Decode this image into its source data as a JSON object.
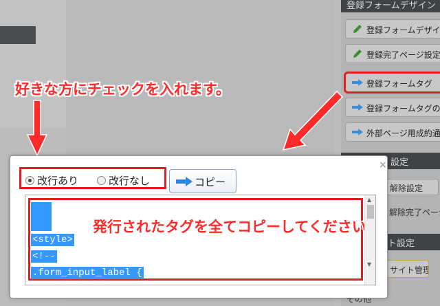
{
  "background": {
    "section_top": "登録フォームデザイン",
    "side_buttons": [
      {
        "label": "登録フォームデザイン"
      },
      {
        "label": "登録完了ページ設定"
      },
      {
        "label": "登録フォームタグ"
      },
      {
        "label": "登録フォームタグの"
      },
      {
        "label": "外部ページ用成約通知"
      }
    ],
    "section_mid": "設定",
    "side_small_1": "解除設定",
    "side_small_2": "解除完了ページ",
    "section_site": "ト設定",
    "site_manage": "サイト管理",
    "bottom_label": "その他"
  },
  "annotations": {
    "callout_top": "好きな方にチェックを入れます。",
    "callout_textarea": "発行されたタグを全てコピーしてください。"
  },
  "dialog": {
    "close": "×",
    "radio_on_label": "改行あり",
    "radio_off_label": "改行なし",
    "copy_label": "コピー",
    "code_lines": [
      "<style>",
      "<!--",
      ".form_input_label {"
    ]
  },
  "colors": {
    "annotation_red": "#e02020",
    "selection_blue": "#3399ff"
  }
}
